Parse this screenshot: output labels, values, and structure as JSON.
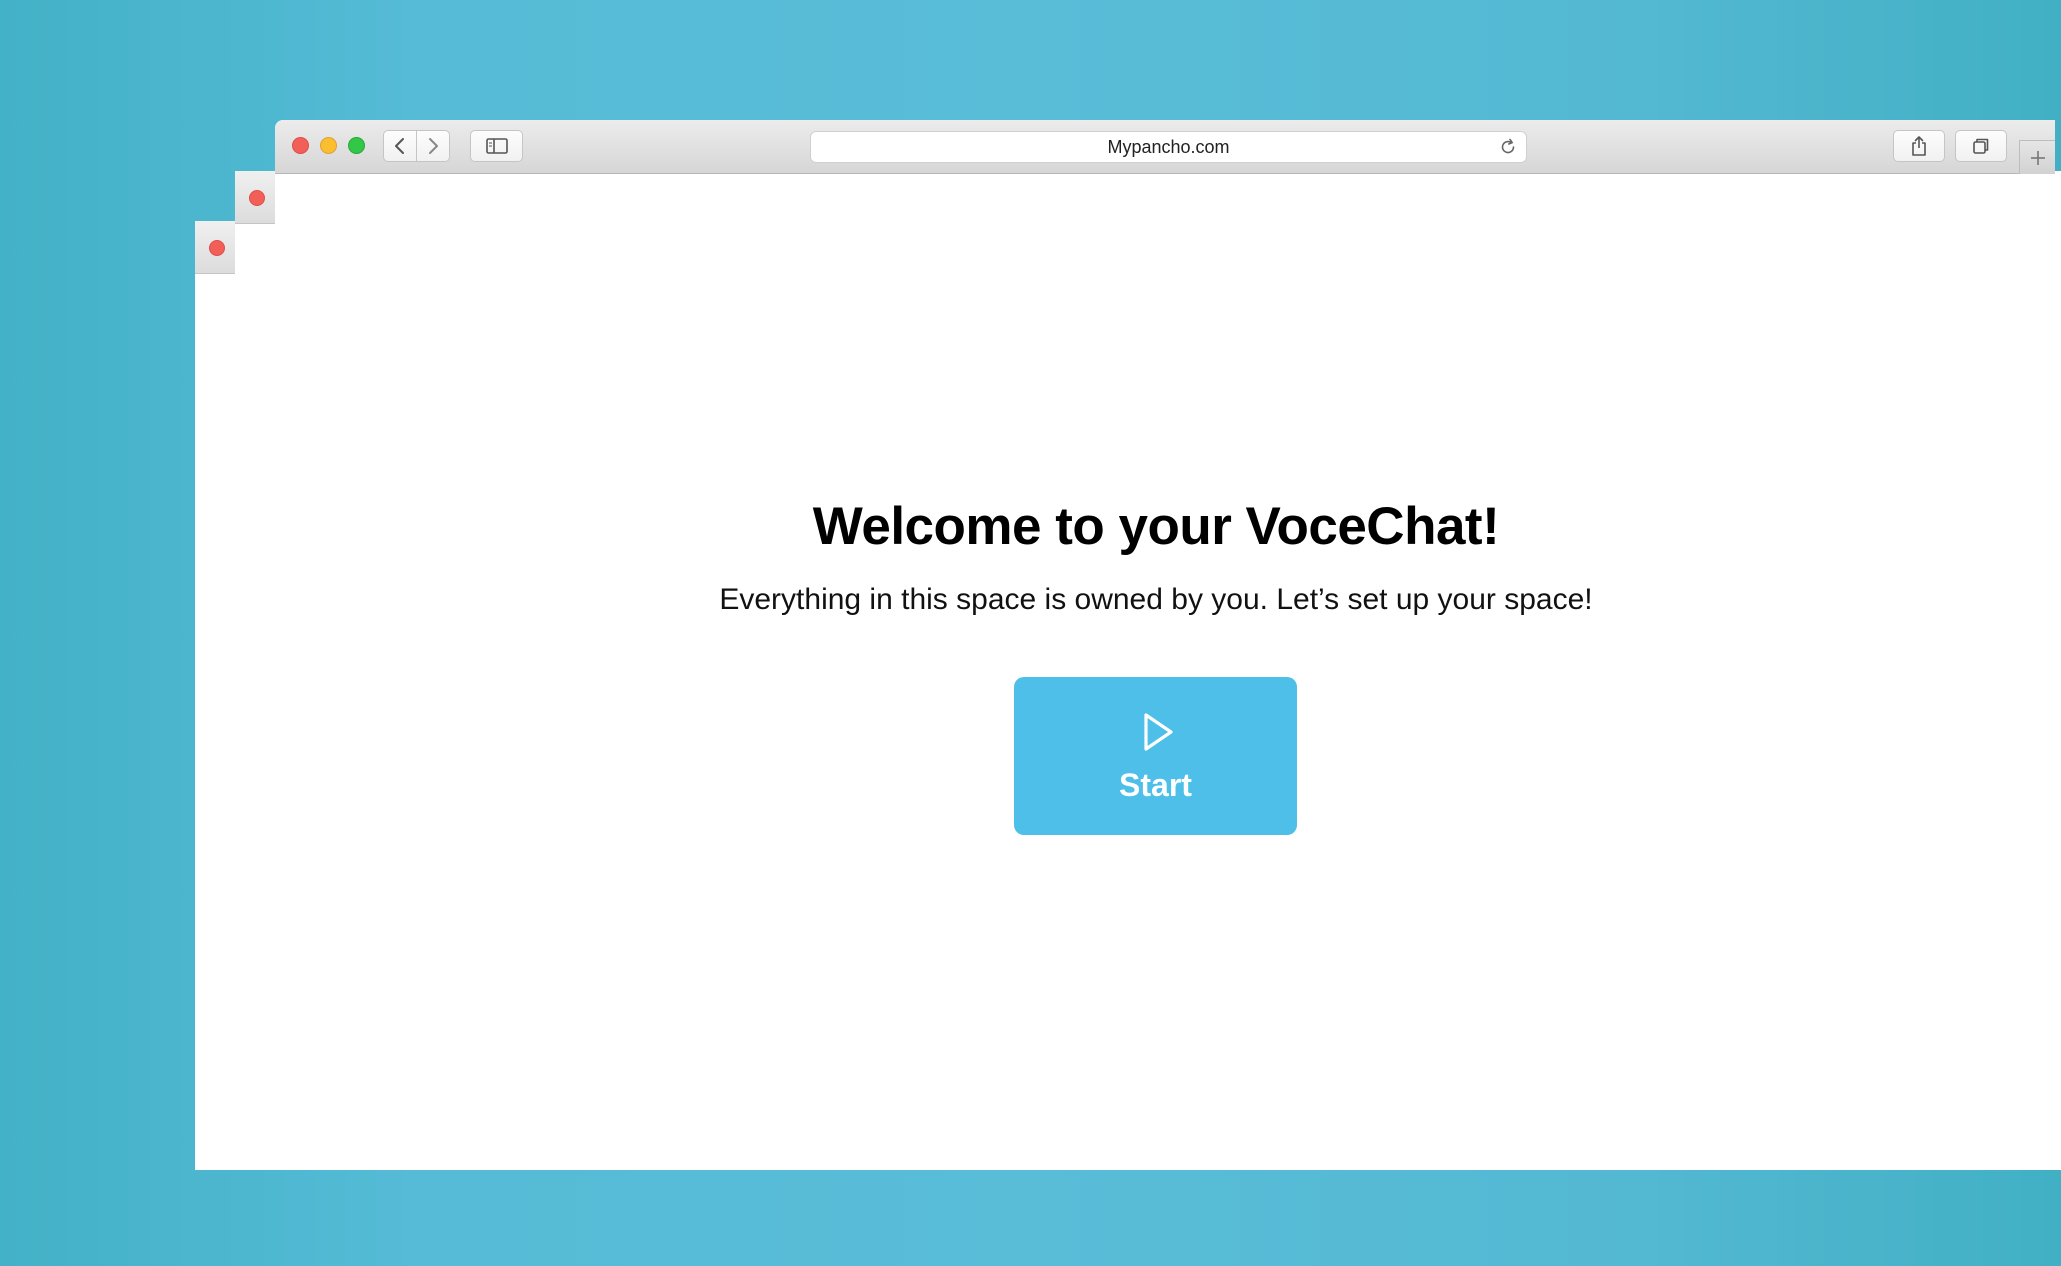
{
  "browser": {
    "address_bar": {
      "url": "Mypancho.com"
    }
  },
  "page": {
    "heading": "Welcome to your VoceChat!",
    "subheading": "Everything in this space is owned by you. Let’s set up your space!",
    "start_button": {
      "label": "Start",
      "icon": "play-icon",
      "color": "#4dbfe8"
    }
  },
  "colors": {
    "background": "#55bbd6",
    "close": "#f25f58",
    "minimize": "#fbbe2e",
    "maximize": "#33c748"
  }
}
